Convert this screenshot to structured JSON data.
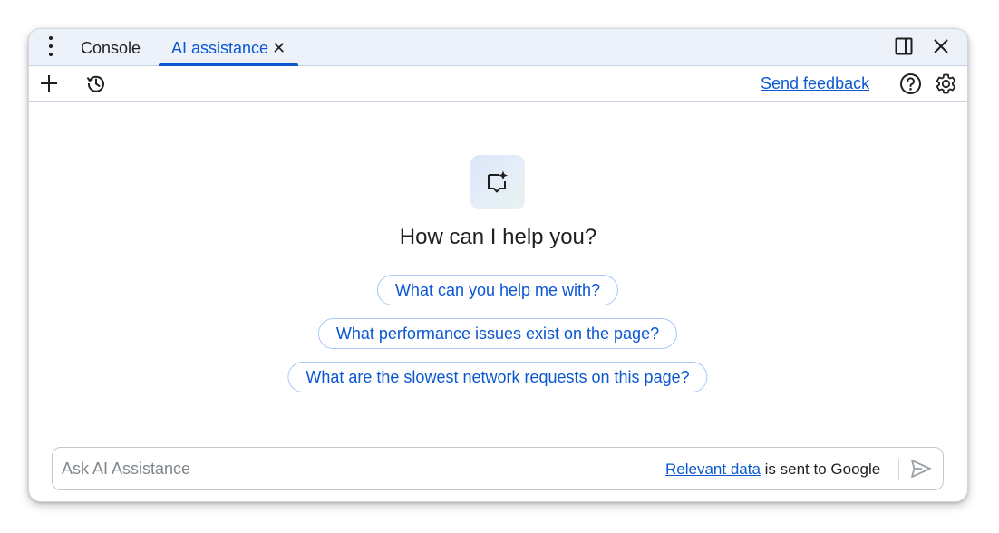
{
  "tabs": [
    {
      "label": "Console",
      "active": false
    },
    {
      "label": "AI assistance",
      "active": true,
      "close_icon": "close-icon"
    }
  ],
  "tabbar": {
    "menu_icon": "more-vert-icon",
    "dock_icon": "dock-side-icon",
    "close_icon": "close-icon"
  },
  "toolbar": {
    "new_chat_icon": "plus-icon",
    "history_icon": "history-icon",
    "feedback_label": "Send feedback",
    "help_icon": "help-icon",
    "settings_icon": "gear-icon"
  },
  "main": {
    "hero_icon": "ai-chat-spark-icon",
    "heading": "How can I help you?",
    "suggestions": [
      "What can you help me with?",
      "What performance issues exist on the page?",
      "What are the slowest network requests on this page?"
    ]
  },
  "input": {
    "placeholder": "Ask AI Assistance",
    "value": "",
    "disclaimer_link": "Relevant data",
    "disclaimer_text": " is sent to Google",
    "send_icon": "send-icon"
  },
  "colors": {
    "accent": "#0b57d0",
    "tabbar_bg": "#edf2fa",
    "chip_border": "#a8c7fa",
    "text": "#1f1f1f",
    "placeholder": "#80868b"
  }
}
